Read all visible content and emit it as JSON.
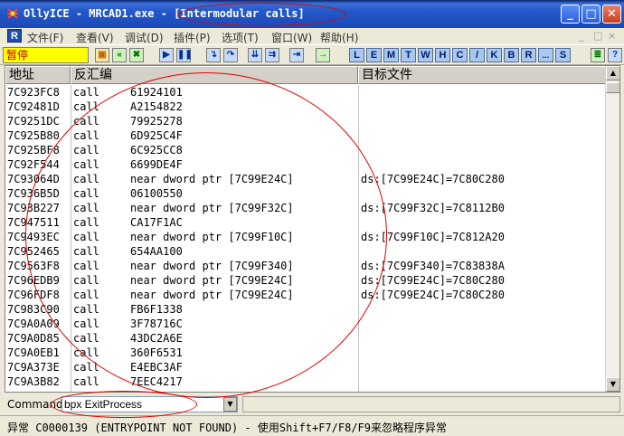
{
  "window": {
    "title_prefix": "OllyICE - MRCAD1.exe - ",
    "title_pane": "[Intermodular calls]",
    "minimize": "_",
    "maximize": "□",
    "close": "✕"
  },
  "menu": {
    "app_icon_label": "R",
    "items": [
      "文件(F)",
      "查看(V)",
      "调试(D)",
      "插件(P)",
      "选项(T)",
      "窗口(W)",
      "帮助(H)"
    ],
    "mdi_controls": [
      "_",
      "□",
      "×"
    ]
  },
  "toolbar": {
    "status": "暂停",
    "letters": [
      "L",
      "E",
      "M",
      "T",
      "W",
      "H",
      "C",
      "/",
      "K",
      "B",
      "R",
      "...",
      "S"
    ]
  },
  "table": {
    "columns": [
      "地址",
      "反汇编",
      "目标文件"
    ],
    "rows": [
      {
        "addr": "7C923FC8",
        "op": "call",
        "arg": "61924101",
        "target": ""
      },
      {
        "addr": "7C92481D",
        "op": "call",
        "arg": "A2154822",
        "target": ""
      },
      {
        "addr": "7C9251DC",
        "op": "call",
        "arg": "79925278",
        "target": ""
      },
      {
        "addr": "7C925B80",
        "op": "call",
        "arg": "6D925C4F",
        "target": ""
      },
      {
        "addr": "7C925BF8",
        "op": "call",
        "arg": "6C925CC8",
        "target": ""
      },
      {
        "addr": "7C92F544",
        "op": "call",
        "arg": "6699DE4F",
        "target": ""
      },
      {
        "addr": "7C93064D",
        "op": "call",
        "arg": "near dword ptr [7C99E24C]",
        "target": "ds:[7C99E24C]=7C80C280"
      },
      {
        "addr": "7C936B5D",
        "op": "call",
        "arg": "06100550",
        "target": ""
      },
      {
        "addr": "7C93B227",
        "op": "call",
        "arg": "near dword ptr [7C99F32C]",
        "target": "ds:[7C99F32C]=7C8112B0"
      },
      {
        "addr": "7C947511",
        "op": "call",
        "arg": "CA17F1AC",
        "target": ""
      },
      {
        "addr": "7C9493EC",
        "op": "call",
        "arg": "near dword ptr [7C99F10C]",
        "target": "ds:[7C99F10C]=7C812A20"
      },
      {
        "addr": "7C952465",
        "op": "call",
        "arg": "654AA100",
        "target": ""
      },
      {
        "addr": "7C9563F8",
        "op": "call",
        "arg": "near dword ptr [7C99F340]",
        "target": "ds:[7C99F340]=7C83838A"
      },
      {
        "addr": "7C96EDB9",
        "op": "call",
        "arg": "near dword ptr [7C99E24C]",
        "target": "ds:[7C99E24C]=7C80C280"
      },
      {
        "addr": "7C96FDF8",
        "op": "call",
        "arg": "near dword ptr [7C99E24C]",
        "target": "ds:[7C99E24C]=7C80C280"
      },
      {
        "addr": "7C983C90",
        "op": "call",
        "arg": "FB6F1338",
        "target": ""
      },
      {
        "addr": "7C9A0A09",
        "op": "call",
        "arg": "3F78716C",
        "target": ""
      },
      {
        "addr": "7C9A0D85",
        "op": "call",
        "arg": "43DC2A6E",
        "target": ""
      },
      {
        "addr": "7C9A0EB1",
        "op": "call",
        "arg": "360F6531",
        "target": ""
      },
      {
        "addr": "7C9A373E",
        "op": "call",
        "arg": "E4EBC3AF",
        "target": ""
      },
      {
        "addr": "7C9A3B82",
        "op": "call",
        "arg": "7EEC4217",
        "target": ""
      }
    ]
  },
  "command": {
    "label": "Command",
    "value": "bpx ExitProcess"
  },
  "status_bar": {
    "text": "异常 C0000139 (ENTRYPOINT NOT FOUND) - 使用Shift+F7/F8/F9来忽略程序异常"
  }
}
